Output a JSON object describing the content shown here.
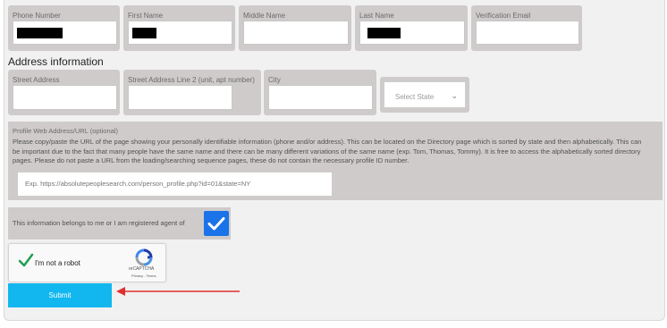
{
  "form": {
    "fields": [
      {
        "label": "Phone Number"
      },
      {
        "label": "First Name"
      },
      {
        "label": "Middle Name"
      },
      {
        "label": "Last Name"
      },
      {
        "label": "Verification Email"
      }
    ],
    "address_heading": "Address information",
    "address_fields": [
      {
        "label": "Street Address"
      },
      {
        "label": "Street Address Line 2 (unit, apt number)"
      },
      {
        "label": "City"
      }
    ],
    "state_select": {
      "placeholder": "Select State"
    },
    "profile_url": {
      "label": "Profile Web Address/URL (optional)",
      "description": "Please copy/paste the URL of the page showing your personally identifiable information (phone and/or address). This can be located on the Directory page which is sorted by state and then alphabetically. This can be important due to the fact that many people have the same name and there can be many different variations of the same name (exp. Tom, Thomas, Tommy). It is free to access the alphabetically sorted directory pages. Please do not paste a URL from the loading/searching sequence pages, these do not contain the necessary profile ID number.",
      "placeholder": "Exp. https://absolutepeoplesearch.com/person_profile.php?id=01&state=NY"
    },
    "consent": {
      "label": "This information belongs to me or I am registered agent of",
      "checked": true
    },
    "captcha": {
      "label": "I'm not a robot",
      "brand": "reCAPTCHA",
      "terms": "Privacy - Terms"
    },
    "submit_label": "Submit"
  },
  "colors": {
    "submit": "#12b7ef",
    "checkbox": "#1a73e8",
    "arrow": "#e03030"
  }
}
